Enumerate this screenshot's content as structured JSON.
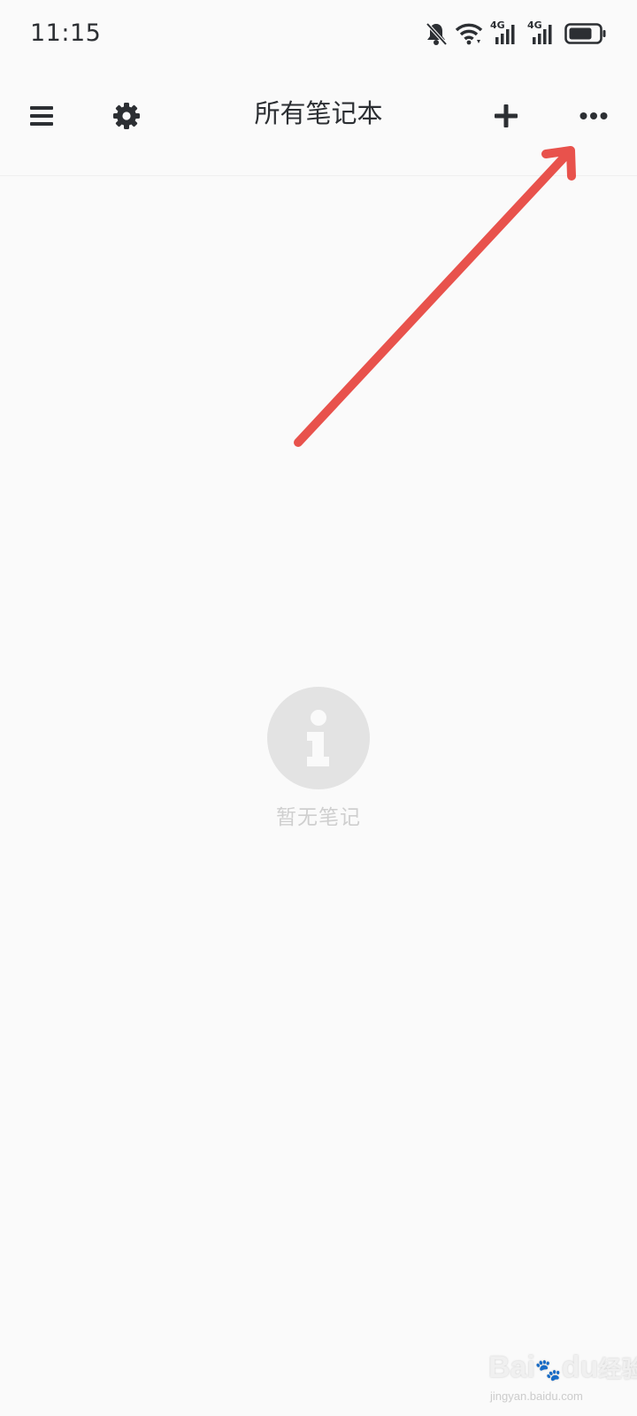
{
  "status_bar": {
    "time": "11:15",
    "icons": [
      "bell-off-icon",
      "wifi-icon",
      "signal-4g-icon",
      "signal-4g-icon",
      "battery-icon"
    ],
    "network_label_1": "4G",
    "network_label_2": "4G"
  },
  "app_bar": {
    "title": "所有笔记本",
    "left_icons": [
      "menu-icon",
      "gear-icon"
    ],
    "right_icons": [
      "plus-icon",
      "more-dots-icon"
    ]
  },
  "empty_state": {
    "icon": "info-icon",
    "message": "暂无笔记"
  },
  "annotation": {
    "type": "arrow",
    "color": "#e8524c",
    "points_to": "more-button"
  },
  "watermark": {
    "brand": "Bai",
    "brand_suffix": "du",
    "product": "经验",
    "url": "jingyan.baidu.com"
  },
  "colors": {
    "background": "#fafafa",
    "text": "#2c2f33",
    "empty_circle": "#e3e3e3",
    "empty_text": "#cfcfcf",
    "arrow": "#e8524c"
  }
}
